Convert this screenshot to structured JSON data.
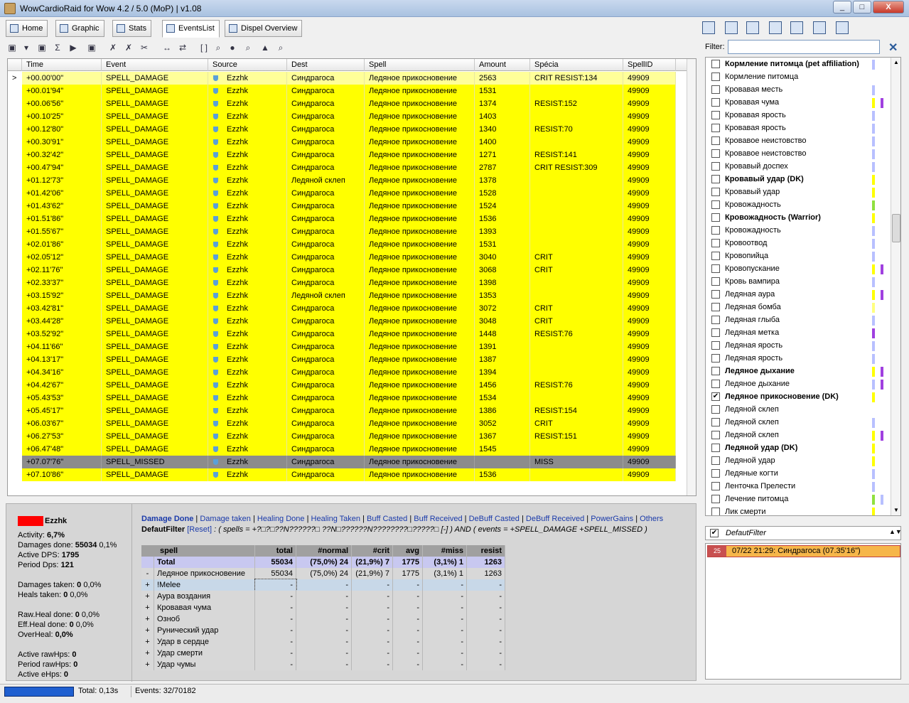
{
  "window": {
    "title": "WowCardioRaid for Wow 4.2 / 5.0 (MoP) | v1.08",
    "min": "_",
    "max": "□",
    "close": "X"
  },
  "tabs": [
    {
      "label": "Home"
    },
    {
      "label": "Graphic"
    },
    {
      "label": "Stats"
    },
    {
      "label": "EventsList",
      "active": true
    },
    {
      "label": "Dispel Overview"
    }
  ],
  "toolbar_icons": [
    "save-icon",
    "dropdown-icon",
    "save-alt-icon",
    "sum-icon",
    "play-icon",
    "export-icon",
    "cross-icon",
    "cross-red-icon",
    "scissors-icon",
    "split-icon",
    "swap-icon",
    "brackets-icon",
    "search-icon",
    "info-icon",
    "search-user-icon",
    "lock-icon",
    "search-person-icon"
  ],
  "grid": {
    "columns": [
      "Time",
      "Event",
      "Source",
      "Dest",
      "Spell",
      "Amount",
      "Spécia",
      "SpellID"
    ],
    "rows": [
      [
        "+00.00'00\"",
        "SPELL_DAMAGE",
        "Ezzhk",
        "Синдрагоса",
        "Ледяное прикосновение",
        "2563",
        "CRIT RESIST:134",
        "49909"
      ],
      [
        "+00.01'94\"",
        "SPELL_DAMAGE",
        "Ezzhk",
        "Синдрагоса",
        "Ледяное прикосновение",
        "1531",
        "",
        "49909"
      ],
      [
        "+00.06'56\"",
        "SPELL_DAMAGE",
        "Ezzhk",
        "Синдрагоса",
        "Ледяное прикосновение",
        "1374",
        "RESIST:152",
        "49909"
      ],
      [
        "+00.10'25\"",
        "SPELL_DAMAGE",
        "Ezzhk",
        "Синдрагоса",
        "Ледяное прикосновение",
        "1403",
        "",
        "49909"
      ],
      [
        "+00.12'80\"",
        "SPELL_DAMAGE",
        "Ezzhk",
        "Синдрагоса",
        "Ледяное прикосновение",
        "1340",
        "RESIST:70",
        "49909"
      ],
      [
        "+00.30'91\"",
        "SPELL_DAMAGE",
        "Ezzhk",
        "Синдрагоса",
        "Ледяное прикосновение",
        "1400",
        "",
        "49909"
      ],
      [
        "+00.32'42\"",
        "SPELL_DAMAGE",
        "Ezzhk",
        "Синдрагоса",
        "Ледяное прикосновение",
        "1271",
        "RESIST:141",
        "49909"
      ],
      [
        "+00.47'94\"",
        "SPELL_DAMAGE",
        "Ezzhk",
        "Синдрагоса",
        "Ледяное прикосновение",
        "2787",
        "CRIT RESIST:309",
        "49909"
      ],
      [
        "+01.12'73\"",
        "SPELL_DAMAGE",
        "Ezzhk",
        "Ледяной склеп",
        "Ледяное прикосновение",
        "1378",
        "",
        "49909"
      ],
      [
        "+01.42'06\"",
        "SPELL_DAMAGE",
        "Ezzhk",
        "Синдрагоса",
        "Ледяное прикосновение",
        "1528",
        "",
        "49909"
      ],
      [
        "+01.43'62\"",
        "SPELL_DAMAGE",
        "Ezzhk",
        "Синдрагоса",
        "Ледяное прикосновение",
        "1524",
        "",
        "49909"
      ],
      [
        "+01.51'86\"",
        "SPELL_DAMAGE",
        "Ezzhk",
        "Синдрагоса",
        "Ледяное прикосновение",
        "1536",
        "",
        "49909"
      ],
      [
        "+01.55'67\"",
        "SPELL_DAMAGE",
        "Ezzhk",
        "Синдрагоса",
        "Ледяное прикосновение",
        "1393",
        "",
        "49909"
      ],
      [
        "+02.01'86\"",
        "SPELL_DAMAGE",
        "Ezzhk",
        "Синдрагоса",
        "Ледяное прикосновение",
        "1531",
        "",
        "49909"
      ],
      [
        "+02.05'12\"",
        "SPELL_DAMAGE",
        "Ezzhk",
        "Синдрагоса",
        "Ледяное прикосновение",
        "3040",
        "CRIT",
        "49909"
      ],
      [
        "+02.11'76\"",
        "SPELL_DAMAGE",
        "Ezzhk",
        "Синдрагоса",
        "Ледяное прикосновение",
        "3068",
        "CRIT",
        "49909"
      ],
      [
        "+02.33'37\"",
        "SPELL_DAMAGE",
        "Ezzhk",
        "Синдрагоса",
        "Ледяное прикосновение",
        "1398",
        "",
        "49909"
      ],
      [
        "+03.15'92\"",
        "SPELL_DAMAGE",
        "Ezzhk",
        "Ледяной склеп",
        "Ледяное прикосновение",
        "1353",
        "",
        "49909"
      ],
      [
        "+03.42'81\"",
        "SPELL_DAMAGE",
        "Ezzhk",
        "Синдрагоса",
        "Ледяное прикосновение",
        "3072",
        "CRIT",
        "49909"
      ],
      [
        "+03.44'28\"",
        "SPELL_DAMAGE",
        "Ezzhk",
        "Синдрагоса",
        "Ледяное прикосновение",
        "3048",
        "CRIT",
        "49909"
      ],
      [
        "+03.52'92\"",
        "SPELL_DAMAGE",
        "Ezzhk",
        "Синдрагоса",
        "Ледяное прикосновение",
        "1448",
        "RESIST:76",
        "49909"
      ],
      [
        "+04.11'66\"",
        "SPELL_DAMAGE",
        "Ezzhk",
        "Синдрагоса",
        "Ледяное прикосновение",
        "1391",
        "",
        "49909"
      ],
      [
        "+04.13'17\"",
        "SPELL_DAMAGE",
        "Ezzhk",
        "Синдрагоса",
        "Ледяное прикосновение",
        "1387",
        "",
        "49909"
      ],
      [
        "+04.34'16\"",
        "SPELL_DAMAGE",
        "Ezzhk",
        "Синдрагоса",
        "Ледяное прикосновение",
        "1394",
        "",
        "49909"
      ],
      [
        "+04.42'67\"",
        "SPELL_DAMAGE",
        "Ezzhk",
        "Синдрагоса",
        "Ледяное прикосновение",
        "1456",
        "RESIST:76",
        "49909"
      ],
      [
        "+05.43'53\"",
        "SPELL_DAMAGE",
        "Ezzhk",
        "Синдрагоса",
        "Ледяное прикосновение",
        "1534",
        "",
        "49909"
      ],
      [
        "+05.45'17\"",
        "SPELL_DAMAGE",
        "Ezzhk",
        "Синдрагоса",
        "Ледяное прикосновение",
        "1386",
        "RESIST:154",
        "49909"
      ],
      [
        "+06.03'67\"",
        "SPELL_DAMAGE",
        "Ezzhk",
        "Синдрагоса",
        "Ледяное прикосновение",
        "3052",
        "CRIT",
        "49909"
      ],
      [
        "+06.27'53\"",
        "SPELL_DAMAGE",
        "Ezzhk",
        "Синдрагоса",
        "Ледяное прикосновение",
        "1367",
        "RESIST:151",
        "49909"
      ],
      [
        "+06.47'48\"",
        "SPELL_DAMAGE",
        "Ezzhk",
        "Синдрагоса",
        "Ледяное прикосновение",
        "1545",
        "",
        "49909"
      ],
      [
        "+07.07'76\"",
        "SPELL_MISSED",
        "Ezzhk",
        "Синдрагоса",
        "Ледяное прикосновение",
        "",
        "MISS",
        "49909"
      ],
      [
        "+07.10'86\"",
        "SPELL_DAMAGE",
        "Ezzhk",
        "Синдрагоса",
        "Ледяное прикосновение",
        "1536",
        "",
        "49909"
      ]
    ],
    "current_row_marker": ">"
  },
  "colors": {
    "row_yellow": "#ffff00",
    "row_selected": "#ffff99",
    "row_missed": "#8c8c8c",
    "player": "#ff0000"
  },
  "filter": {
    "label": "Filter:",
    "value": "",
    "clear": "✕"
  },
  "filter_items": [
    {
      "label": "Кормление питомца (pet affiliation)",
      "bold": true,
      "checked": false,
      "bars": [
        "#b8c0ff"
      ]
    },
    {
      "label": "Кормление питомца",
      "bold": false,
      "checked": false,
      "bars": []
    },
    {
      "label": "Кровавая месть",
      "bold": false,
      "checked": false,
      "bars": [
        "#b8c0ff"
      ]
    },
    {
      "label": "Кровавая чума",
      "bold": false,
      "checked": false,
      "bars": [
        "#ffff00",
        "#a040e0"
      ]
    },
    {
      "label": "Кровавая ярость",
      "bold": false,
      "checked": false,
      "bars": [
        "#b8c0ff"
      ]
    },
    {
      "label": "Кровавая ярость",
      "bold": false,
      "checked": false,
      "bars": [
        "#b8c0ff"
      ]
    },
    {
      "label": "Кровавое неистовство",
      "bold": false,
      "checked": false,
      "bars": [
        "#b8c0ff"
      ]
    },
    {
      "label": "Кровавое неистовство",
      "bold": false,
      "checked": false,
      "bars": [
        "#b8c0ff"
      ]
    },
    {
      "label": "Кровавый доспех",
      "bold": false,
      "checked": false,
      "bars": [
        "#b8c0ff"
      ]
    },
    {
      "label": "Кровавый удар (DK)",
      "bold": true,
      "checked": false,
      "bars": [
        "#ffff00"
      ]
    },
    {
      "label": "Кровавый удар",
      "bold": false,
      "checked": false,
      "bars": [
        "#ffff00"
      ]
    },
    {
      "label": "Кровожадность",
      "bold": false,
      "checked": false,
      "bars": [
        "#90e040"
      ]
    },
    {
      "label": "Кровожадность (Warrior)",
      "bold": true,
      "checked": false,
      "bars": [
        "#ffff00"
      ]
    },
    {
      "label": "Кровожадность",
      "bold": false,
      "checked": false,
      "bars": [
        "#b8c0ff"
      ]
    },
    {
      "label": "Кровоотвод",
      "bold": false,
      "checked": false,
      "bars": [
        "#b8c0ff"
      ]
    },
    {
      "label": "Кровопийца",
      "bold": false,
      "checked": false,
      "bars": [
        "#b8c0ff"
      ]
    },
    {
      "label": "Кровопускание",
      "bold": false,
      "checked": false,
      "bars": [
        "#ffff00",
        "#a040e0"
      ]
    },
    {
      "label": "Кровь вампира",
      "bold": false,
      "checked": false,
      "bars": [
        "#b8c0ff"
      ]
    },
    {
      "label": "Ледяная аура",
      "bold": false,
      "checked": false,
      "bars": [
        "#ffff00",
        "#a040e0"
      ]
    },
    {
      "label": "Ледяная бомба",
      "bold": false,
      "checked": false,
      "bars": [
        "#ffff80"
      ]
    },
    {
      "label": "Ледяная глыба",
      "bold": false,
      "checked": false,
      "bars": [
        "#b8c0ff"
      ]
    },
    {
      "label": "Ледяная метка",
      "bold": false,
      "checked": false,
      "bars": [
        "#a040e0"
      ]
    },
    {
      "label": "Ледяная ярость",
      "bold": false,
      "checked": false,
      "bars": [
        "#b8c0ff"
      ]
    },
    {
      "label": "Ледяная ярость",
      "bold": false,
      "checked": false,
      "bars": [
        "#b8c0ff"
      ]
    },
    {
      "label": "Ледяное дыхание",
      "bold": true,
      "checked": false,
      "bars": [
        "#ffff00",
        "#a040e0"
      ]
    },
    {
      "label": "Ледяное дыхание",
      "bold": false,
      "checked": false,
      "bars": [
        "#b8c0ff",
        "#a040e0"
      ]
    },
    {
      "label": "Ледяное прикосновение (DK)",
      "bold": true,
      "checked": true,
      "bars": [
        "#ffff00"
      ]
    },
    {
      "label": "Ледяной склеп",
      "bold": false,
      "checked": false,
      "bars": []
    },
    {
      "label": "Ледяной склеп",
      "bold": false,
      "checked": false,
      "bars": [
        "#b8c0ff"
      ]
    },
    {
      "label": "Ледяной склеп",
      "bold": false,
      "checked": false,
      "bars": [
        "#ffff00",
        "#a040e0"
      ]
    },
    {
      "label": "Ледяной удар (DK)",
      "bold": true,
      "checked": false,
      "bars": [
        "#ffff00"
      ]
    },
    {
      "label": "Ледяной удар",
      "bold": false,
      "checked": false,
      "bars": [
        "#ffff00"
      ]
    },
    {
      "label": "Ледяные когти",
      "bold": false,
      "checked": false,
      "bars": [
        "#b8c0ff"
      ]
    },
    {
      "label": "Ленточка Прелести",
      "bold": false,
      "checked": false,
      "bars": [
        "#b8c0ff"
      ]
    },
    {
      "label": "Лечение питомца",
      "bold": false,
      "checked": false,
      "bars": [
        "#90e040",
        "#b8c0ff"
      ]
    },
    {
      "label": "Лик смерти",
      "bold": false,
      "checked": false,
      "bars": [
        "#ffff00"
      ]
    }
  ],
  "default_filter": {
    "label": "DefautFilter",
    "checked": true
  },
  "encounters": [
    {
      "num": "25",
      "text": "07/22  21:29: Синдрагоса (07.35'16\")"
    }
  ],
  "player": {
    "name": "Ezzhk",
    "stats": [
      {
        "label": "Activity:",
        "value": "6,7%"
      },
      {
        "label": "Damages done:",
        "value": "55034",
        "extra": "0,1%"
      },
      {
        "label": "Active DPS:",
        "value": "1795"
      },
      {
        "label": "Period Dps:",
        "value": "121"
      },
      {
        "label": "Damages taken:",
        "value": "0",
        "extra": "0,0%"
      },
      {
        "label": "Heals taken:",
        "value": "0",
        "extra": "0,0%"
      },
      {
        "label": "Raw.Heal done:",
        "value": "0",
        "extra": "0,0%"
      },
      {
        "label": "Eff.Heal done:",
        "value": "0",
        "extra": "0,0%"
      },
      {
        "label": "OverHeal:",
        "value": "0,0%"
      },
      {
        "label": "Active rawHps:",
        "value": "0"
      },
      {
        "label": "Period rawHps:",
        "value": "0"
      },
      {
        "label": "Active eHps:",
        "value": "0"
      }
    ]
  },
  "links": [
    "Damage Done",
    "Damage taken",
    "Healing Done",
    "Healing Taken",
    "Buff Casted",
    "Buff Received",
    "DeBuff Casted",
    "DeBuff Received",
    "PowerGains",
    "Others"
  ],
  "filter_line": {
    "name": "DefautFilter",
    "reset": "[Reset]",
    "text": ": ( spells = +?□?□??N??????□ ??N□??????N????????□?????□ [-] ) AND ( events = +SPELL_DAMAGE +SPELL_MISSED )"
  },
  "spell_table": {
    "headers": [
      "spell",
      "total",
      "#normal",
      "#crit",
      "avg",
      "#miss",
      "resist"
    ],
    "rows": [
      {
        "exp": "",
        "spell": "Total",
        "total": "55034",
        "normal": "(75,0%)  24",
        "crit": "(21,9%)  7",
        "avg": "1775",
        "miss": "(3,1%)  1",
        "resist": "1263",
        "type": "total"
      },
      {
        "exp": "-",
        "spell": "Ледяное прикосновение",
        "total": "55034",
        "normal": "(75,0%)  24",
        "crit": "(21,9%)  7",
        "avg": "1775",
        "miss": "(3,1%)  1",
        "resist": "1263",
        "type": "main"
      },
      {
        "exp": "+",
        "spell": "!Melee",
        "total": "-",
        "normal": "-",
        "crit": "-",
        "avg": "-",
        "miss": "-",
        "resist": "-",
        "type": "sel"
      },
      {
        "exp": "+",
        "spell": "Аура воздания",
        "total": "-",
        "normal": "-",
        "crit": "-",
        "avg": "-",
        "miss": "-",
        "resist": "-",
        "type": ""
      },
      {
        "exp": "+",
        "spell": "Кровавая чума",
        "total": "-",
        "normal": "-",
        "crit": "-",
        "avg": "-",
        "miss": "-",
        "resist": "-",
        "type": ""
      },
      {
        "exp": "+",
        "spell": "Озноб",
        "total": "-",
        "normal": "-",
        "crit": "-",
        "avg": "-",
        "miss": "-",
        "resist": "-",
        "type": ""
      },
      {
        "exp": "+",
        "spell": "Рунический удар",
        "total": "-",
        "normal": "-",
        "crit": "-",
        "avg": "-",
        "miss": "-",
        "resist": "-",
        "type": ""
      },
      {
        "exp": "+",
        "spell": "Удар в сердце",
        "total": "-",
        "normal": "-",
        "crit": "-",
        "avg": "-",
        "miss": "-",
        "resist": "-",
        "type": ""
      },
      {
        "exp": "+",
        "spell": "Удар смерти",
        "total": "-",
        "normal": "-",
        "crit": "-",
        "avg": "-",
        "miss": "-",
        "resist": "-",
        "type": ""
      },
      {
        "exp": "+",
        "spell": "Удар чумы",
        "total": "-",
        "normal": "-",
        "crit": "-",
        "avg": "-",
        "miss": "-",
        "resist": "-",
        "type": ""
      }
    ]
  },
  "status": {
    "total": "Total: 0,13s",
    "events": "Events: 32/70182",
    "progress": 1.0
  }
}
